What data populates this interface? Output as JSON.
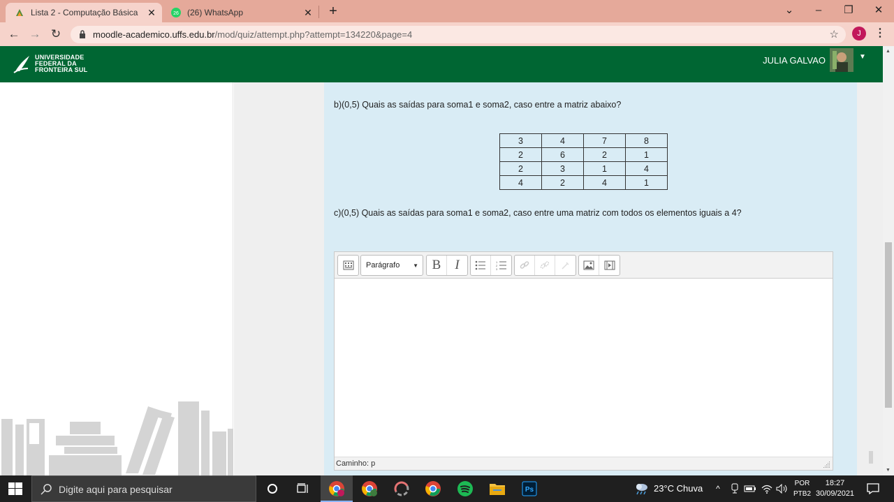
{
  "browser": {
    "tabs": [
      {
        "title": "Lista 2 - Computação Básica",
        "close": "✕"
      },
      {
        "title": "(26) WhatsApp",
        "badge": "26",
        "close": "✕"
      }
    ],
    "new_tab": "+",
    "window_controls": {
      "minimize": "–",
      "maximize": "❐",
      "close": "✕",
      "tab_search": "⌄"
    },
    "url_host": "moodle-academico.uffs.edu.br",
    "url_path": "/mod/quiz/attempt.php?attempt=134220&page=4",
    "profile_initial": "J"
  },
  "header": {
    "logo_lines": [
      "UNIVERSIDADE",
      "FEDERAL DA",
      "FRONTEIRA SUL"
    ],
    "user_name": "JULIA GALVAO"
  },
  "question": {
    "part_b": "b)(0,5) Quais as saídas para soma1 e soma2, caso entre a matriz abaixo?",
    "matrix": [
      [
        "3",
        "4",
        "7",
        "8"
      ],
      [
        "2",
        "6",
        "2",
        "1"
      ],
      [
        "2",
        "3",
        "1",
        "4"
      ],
      [
        "4",
        "2",
        "4",
        "1"
      ]
    ],
    "part_c": "c)(0,5) Quais as saídas para soma1 e soma2, caso entre uma matriz com todos os elementos iguais a 4?"
  },
  "editor": {
    "paragraph_select": "Parágrafo",
    "path_label": "Caminho: p",
    "bold": "B",
    "italic": "I"
  },
  "taskbar": {
    "search_placeholder": "Digite aqui para pesquisar",
    "weather": "23°C  Chuva",
    "lang_line1": "POR",
    "lang_line2": "PTB2",
    "time": "18:27",
    "date": "30/09/2021"
  }
}
